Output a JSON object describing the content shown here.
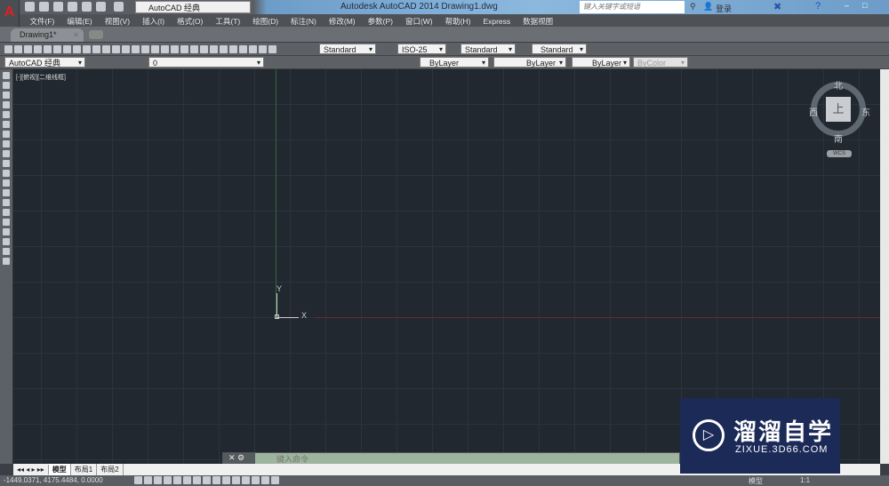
{
  "titlebar": {
    "workspace": "AutoCAD 经典",
    "title": "Autodesk AutoCAD 2014    Drawing1.dwg",
    "search_placeholder": "键入关键字或短语",
    "login": "登录"
  },
  "menu": [
    "文件(F)",
    "编辑(E)",
    "视图(V)",
    "插入(I)",
    "格式(O)",
    "工具(T)",
    "绘图(D)",
    "标注(N)",
    "修改(M)",
    "参数(P)",
    "窗口(W)",
    "帮助(H)",
    "Express",
    "数据视图"
  ],
  "tab": {
    "label": "Drawing1*"
  },
  "toolbar1": {
    "text_style": "Standard",
    "dim_style": "ISO-25",
    "table_style": "Standard",
    "mleader_style": "Standard"
  },
  "toolbar2": {
    "workspace": "AutoCAD 经典",
    "layer": "0",
    "color": "ByLayer",
    "linetype": "ByLayer",
    "lineweight": "ByLayer",
    "plotstyle": "ByColor"
  },
  "viewport": {
    "label": "[-][俯视][二维线框]",
    "cube_face": "上",
    "north": "北",
    "south": "南",
    "east": "东",
    "west": "西",
    "wcs": "WCS",
    "y_label": "Y",
    "x_label": "X"
  },
  "command": {
    "placeholder": "键入命令"
  },
  "layout_tabs": [
    "模型",
    "布局1",
    "布局2"
  ],
  "status": {
    "coords": "-1449.0371, 4175.4484, 0.0000",
    "model": "模型",
    "scale": "1:1"
  },
  "watermark": {
    "title": "溜溜自学",
    "url": "ZIXUE.3D66.COM"
  }
}
